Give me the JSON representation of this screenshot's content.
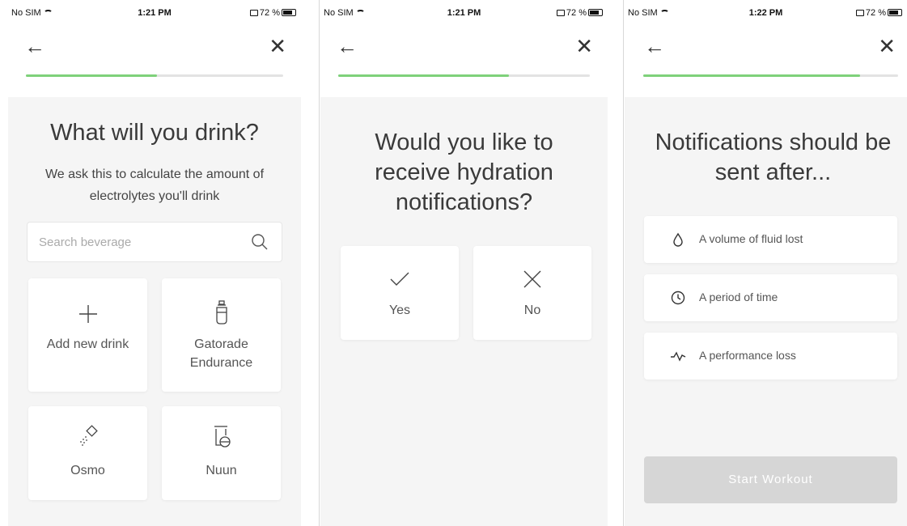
{
  "statusbar": {
    "carrier": "No SIM",
    "battery": "72 %"
  },
  "screens": [
    {
      "time": "1:21 PM",
      "progress": 0.51,
      "title": "What will you drink?",
      "subtitle": "We ask this to calculate the amount of electrolytes you'll drink",
      "search": {
        "placeholder": "Search beverage"
      },
      "drinks": [
        {
          "label": "Add new drink",
          "icon": "plus-icon"
        },
        {
          "label": "Gatorade Endurance",
          "icon": "bottle-icon"
        },
        {
          "label": "Osmo",
          "icon": "powder-sachet-icon"
        },
        {
          "label": "Nuun",
          "icon": "tablet-tube-icon"
        }
      ]
    },
    {
      "time": "1:21 PM",
      "progress": 0.68,
      "title": "Would you like to receive hydration notifications?",
      "choices": [
        {
          "label": "Yes",
          "icon": "check-icon"
        },
        {
          "label": "No",
          "icon": "x-icon"
        }
      ]
    },
    {
      "time": "1:22 PM",
      "progress": 0.85,
      "title": "Notifications should be sent after...",
      "options": [
        {
          "label": "A volume of fluid lost",
          "icon": "drop-icon"
        },
        {
          "label": "A period of time",
          "icon": "clock-icon"
        },
        {
          "label": "A performance loss",
          "icon": "pulse-icon"
        }
      ],
      "cta": "Start Workout"
    }
  ],
  "colors": {
    "progress": "#7ed17a",
    "track": "#e3e3e3",
    "disabled_button": "#d6d6d6"
  }
}
